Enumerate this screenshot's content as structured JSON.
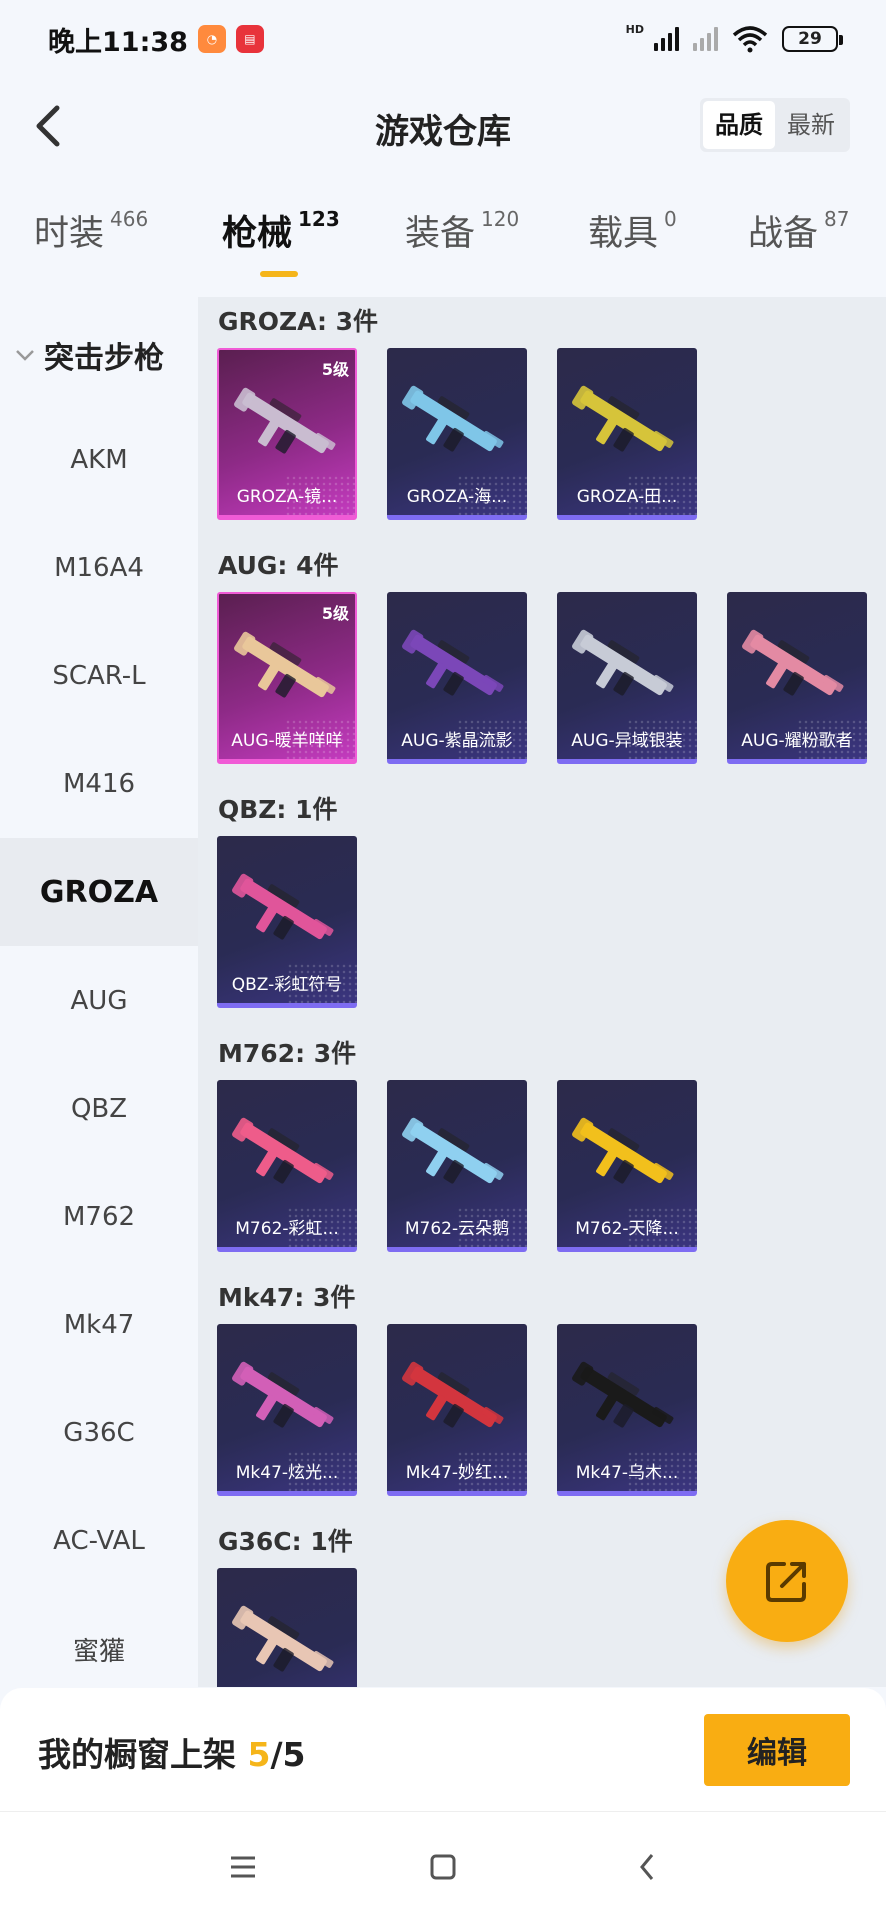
{
  "status_bar": {
    "time": "晚上11:38",
    "hd": "HD",
    "battery": "29"
  },
  "header": {
    "title": "游戏仓库",
    "sort": [
      "品质",
      "最新"
    ]
  },
  "tabs": [
    {
      "label": "时装",
      "count": "466"
    },
    {
      "label": "枪械",
      "count": "123"
    },
    {
      "label": "装备",
      "count": "120"
    },
    {
      "label": "载具",
      "count": "0"
    },
    {
      "label": "战备",
      "count": "87"
    }
  ],
  "sidebar": {
    "heading": "突击步枪",
    "items": [
      "AKM",
      "M16A4",
      "SCAR-L",
      "M416",
      "GROZA",
      "AUG",
      "QBZ",
      "M762",
      "Mk47",
      "G36C",
      "AC-VAL",
      "蜜獾"
    ]
  },
  "groups": [
    {
      "title": "GROZA: 3件",
      "items": [
        {
          "label": "GROZA-镜...",
          "tag": "5级",
          "rarity": "epic",
          "color": "#c9bcd0"
        },
        {
          "label": "GROZA-海...",
          "tag": "",
          "rarity": "rare",
          "color": "#7fc6e8"
        },
        {
          "label": "GROZA-田...",
          "tag": "",
          "rarity": "rare",
          "color": "#d6c43a"
        }
      ]
    },
    {
      "title": "AUG: 4件",
      "items": [
        {
          "label": "AUG-暖羊咩咩",
          "tag": "5级",
          "rarity": "epic",
          "color": "#e9c79a"
        },
        {
          "label": "AUG-紫晶流影",
          "tag": "",
          "rarity": "rare",
          "color": "#7b47b8"
        },
        {
          "label": "AUG-异域银装",
          "tag": "",
          "rarity": "rare",
          "color": "#c7cbd6"
        },
        {
          "label": "AUG-耀粉歌者",
          "tag": "",
          "rarity": "rare",
          "color": "#e38aa3"
        }
      ]
    },
    {
      "title": "QBZ: 1件",
      "items": [
        {
          "label": "QBZ-彩虹符号",
          "tag": "",
          "rarity": "rare",
          "color": "#e0559a"
        }
      ]
    },
    {
      "title": "M762: 3件",
      "items": [
        {
          "label": "M762-彩虹...",
          "tag": "",
          "rarity": "rare",
          "color": "#ee5c8a"
        },
        {
          "label": "M762-云朵鹅",
          "tag": "",
          "rarity": "rare",
          "color": "#8fd0f0"
        },
        {
          "label": "M762-天降...",
          "tag": "",
          "rarity": "rare",
          "color": "#f2c01c"
        }
      ]
    },
    {
      "title": "Mk47: 3件",
      "items": [
        {
          "label": "Mk47-炫光...",
          "tag": "",
          "rarity": "rare",
          "color": "#d25fb7"
        },
        {
          "label": "Mk47-妙红...",
          "tag": "",
          "rarity": "rare",
          "color": "#d3353e"
        },
        {
          "label": "Mk47-乌木...",
          "tag": "",
          "rarity": "rare",
          "color": "#1a1a1a"
        }
      ]
    },
    {
      "title": "G36C: 1件",
      "items": [
        {
          "label": "",
          "tag": "",
          "rarity": "rare",
          "color": "#e8c6b4"
        }
      ]
    }
  ],
  "bottom": {
    "label": "我的橱窗上架 ",
    "count": "5",
    "total": "/5",
    "edit": "编辑"
  },
  "icons": {
    "back": "back-arrow-icon",
    "share": "share-external-icon",
    "menu": "menu-icon",
    "home": "home-icon",
    "nav_back": "nav-back-icon"
  },
  "colors": {
    "accent": "#f9ad12",
    "epic": "#f05bd6",
    "rare": "#7e6cf2"
  }
}
